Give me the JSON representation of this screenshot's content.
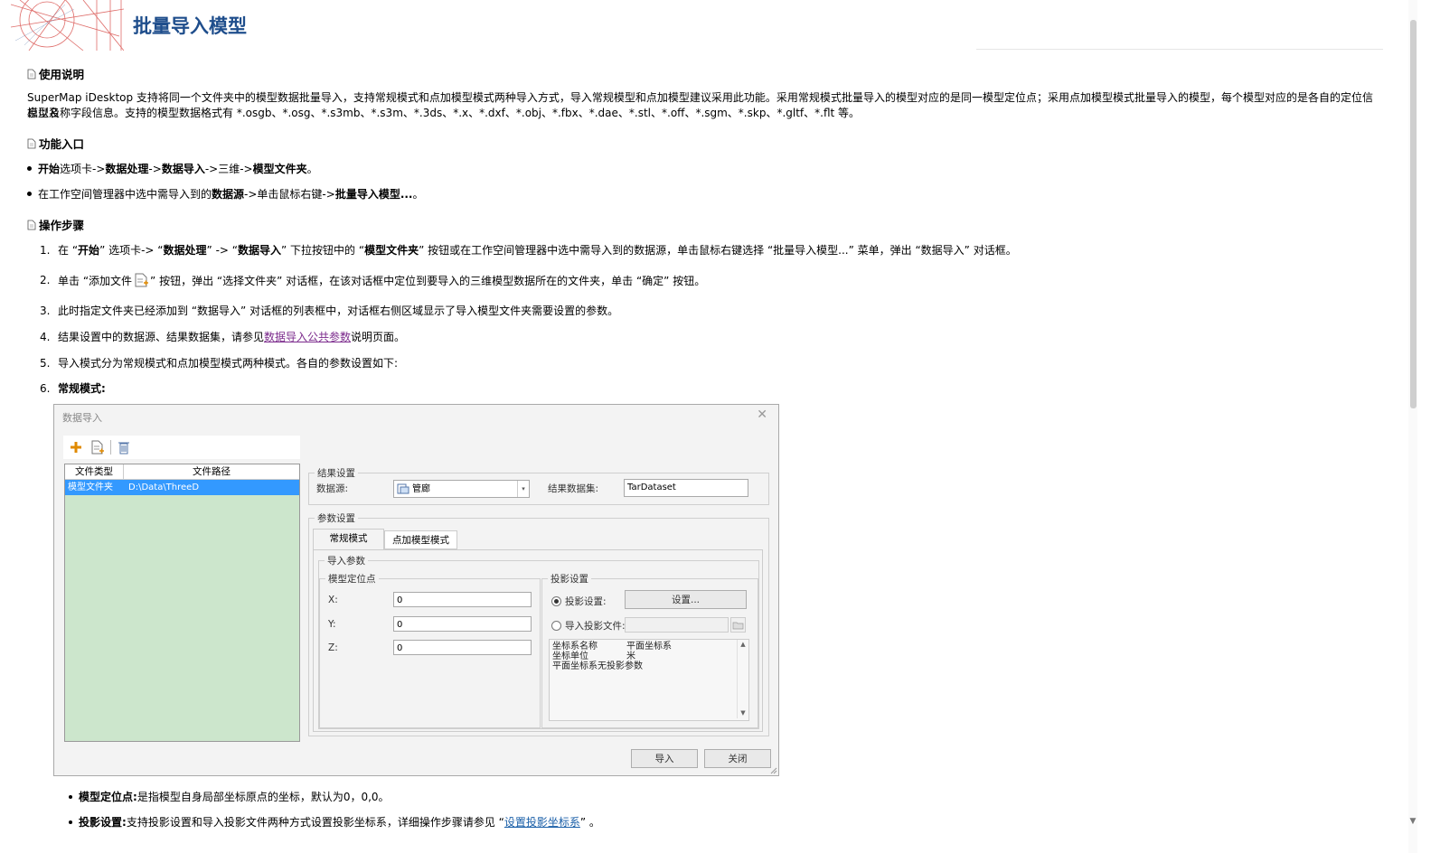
{
  "page": {
    "title": "批量导入模型"
  },
  "sections": {
    "usage": {
      "heading": "使用说明",
      "p1": "SuperMap iDesktop 支持将同一个文件夹中的模型数据批量导入，支持常规模式和点加模型模式两种导入方式，导入常规模型和点加模型建议采用此功能。采用常规模式批量导入的模型对应的是同一模型定位点；采用点加模型模式批量导入的模型，每个模型对应的是各自的定位信息以及",
      "p2": "模型名称字段信息。支持的模型数据格式有 *.osgb、*.osg、*.s3mb、*.s3m、*.3ds、*.x、*.dxf、*.obj、*.fbx、*.dae、*.stl、*.off、*.sgm、*.skp、*.gltf、*.flt 等。"
    },
    "entry": {
      "heading": "功能入口",
      "b1": {
        "a": "开始",
        "b": "选项卡->",
        "c": "数据处理",
        "d": "->",
        "e": "数据导入",
        "f": "->三维->",
        "g": "模型文件夹",
        "h": "。"
      },
      "b2": {
        "a": "在工作空间管理器中选中需导入到的",
        "b": "数据源",
        "c": "->单击鼠标右键->",
        "d": "批量导入模型...",
        "e": "。"
      }
    },
    "steps": {
      "heading": "操作步骤",
      "s1": {
        "n": "1.",
        "a": "在 “",
        "b": "开始",
        "c": "” 选项卡-> “",
        "d": "数据处理",
        "e": "” -> “",
        "f": "数据导入",
        "g": "” 下拉按钮中的 “",
        "h": "模型文件夹",
        "i": "” 按钮或在工作空间管理器中选中需导入到的数据源，单击鼠标右键选择 “批量导入模型...” 菜单，弹出 “数据导入” 对话框。"
      },
      "s2": {
        "n": "2.",
        "a": "单击 “添加文件",
        "b": "” 按钮，弹出 “选择文件夹” 对话框，在该对话框中定位到要导入的三维模型数据所在的文件夹，单击 “确定” 按钮。"
      },
      "s3": {
        "n": "3.",
        "a": "此时指定文件夹已经添加到 “数据导入” 对话框的列表框中，对话框右侧区域显示了导入模型文件夹需要设置的参数。"
      },
      "s4": {
        "n": "4.",
        "a": "结果设置中的数据源、结果数据集，请参见",
        "link": "数据导入公共参数",
        "b": "说明页面。"
      },
      "s5": {
        "n": "5.",
        "a": "导入模式分为常规模式和点加模型模式两种模式。各自的参数设置如下:"
      },
      "s6": {
        "n": "6.",
        "a": "常规模式:"
      }
    },
    "notes": {
      "n1": {
        "a": "模型定位点:",
        "b": " 是指模型自身局部坐标原点的坐标，默认为0，0,0。"
      },
      "n2": {
        "a": "投影设置:",
        "b": " 支持投影设置和导入投影文件两种方式设置投影坐标系，详细操作步骤请参见 “",
        "link": "设置投影坐标系",
        "c": "” 。"
      }
    }
  },
  "dialog": {
    "title": "数据导入",
    "close": "✕",
    "toolbar": {
      "add_icon": "plus-icon",
      "addfile_icon": "add-file-icon",
      "delete_icon": "trash-icon"
    },
    "list": {
      "headers": [
        "文件类型",
        "文件路径"
      ],
      "rows": [
        {
          "type": "模型文件夹",
          "path": "D:\\Data\\ThreeD"
        }
      ]
    },
    "result": {
      "legend": "结果设置",
      "datasource_label": "数据源:",
      "datasource_value": "管廊",
      "dataset_label": "结果数据集:",
      "dataset_value": "TarDataset"
    },
    "params": {
      "legend": "参数设置",
      "tabs": [
        "常规模式",
        "点加模型模式"
      ],
      "import_legend": "导入参数",
      "anchor": {
        "legend": "模型定位点",
        "x_label": "X:",
        "x_value": "0",
        "y_label": "Y:",
        "y_value": "0",
        "z_label": "Z:",
        "z_value": "0"
      },
      "proj": {
        "legend": "投影设置",
        "opt1": "投影设置:",
        "btn": "设置...",
        "opt2": "导入投影文件:",
        "info1_k": "坐标系名称",
        "info1_v": "平面坐标系",
        "info2_k": "坐标单位",
        "info2_v": "米",
        "info3": "平面坐标系无投影参数"
      }
    },
    "buttons": {
      "import": "导入",
      "close": "关闭"
    }
  },
  "colors": {
    "title": "#1f4e8c",
    "selected_row": "#3399ff",
    "list_bg": "#cce6cc",
    "link": "#7b2a8c"
  }
}
